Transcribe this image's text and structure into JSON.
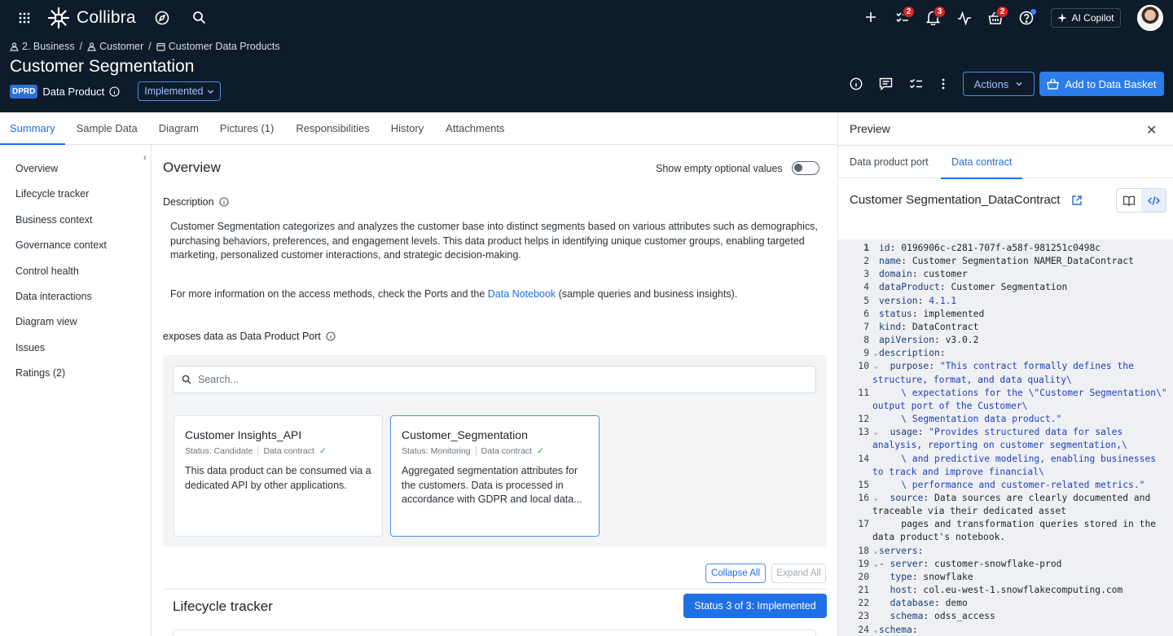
{
  "app": {
    "brand": "Collibra",
    "copilot_label": "AI Copilot",
    "tasks_count": "2",
    "notifications_count": "3",
    "basket_count": "2"
  },
  "breadcrumb": [
    "2. Business",
    "Customer",
    "Customer Data Products"
  ],
  "page": {
    "title": "Customer Segmentation",
    "type_badge": "DPRD",
    "type_label": "Data Product",
    "status": "Implemented",
    "actions_label": "Actions",
    "basket_label": "Add to Data Basket"
  },
  "tabs": [
    "Summary",
    "Sample Data",
    "Diagram",
    "Pictures (1)",
    "Responsibilities",
    "History",
    "Attachments"
  ],
  "leftnav": [
    "Overview",
    "Lifecycle tracker",
    "Business context",
    "Governance context",
    "Control health",
    "Data interactions",
    "Diagram view",
    "Issues",
    "Ratings (2)"
  ],
  "overview": {
    "heading": "Overview",
    "toggle_label": "Show empty optional values",
    "description_label": "Description",
    "description": "Customer Segmentation categorizes and analyzes the customer base into distinct segments based on various attributes such as demographics, purchasing behaviors, preferences, and engagement levels. This data product helps in identifying unique customer groups, enabling targeted marketing, personalized customer interactions, and strategic decision-making.",
    "more_info_pre": "For more information on the access methods, check the Ports and the ",
    "more_info_link": "Data Notebook",
    "more_info_post": " (sample queries and business insights).",
    "exposes_bold": "exposes data as",
    "exposes_rest": " Data Product Port",
    "search_placeholder": "Search...",
    "cards": [
      {
        "title": "Customer Insights_API",
        "status": "Status: Candidate",
        "contract": "Data contract",
        "body": "This data product can be consumed via a dedicated API by other applications."
      },
      {
        "title": "Customer_Segmentation",
        "status": "Status: Monitoring",
        "contract": "Data contract",
        "body": "Aggregated segmentation attributes for the customers. Data is processed in accordance with GDPR and local data..."
      }
    ],
    "collapse_all": "Collapse All",
    "expand_all": "Expand All",
    "lifecycle_title": "Lifecycle tracker",
    "lifecycle_status": "Status 3 of 3: Implemented"
  },
  "preview": {
    "title": "Preview",
    "tabs": [
      "Data product port",
      "Data contract"
    ],
    "contract_title": "Customer Segmentation_DataContract",
    "code_lines": [
      {
        "n": "1",
        "fold": "",
        "k": "id",
        "v": " 0196906c-c281-707f-a58f-981251c0498c"
      },
      {
        "n": "2",
        "fold": "",
        "k": "name",
        "v": " Customer Segmentation NAMER_DataContract"
      },
      {
        "n": "3",
        "fold": "",
        "k": "domain",
        "v": " customer"
      },
      {
        "n": "4",
        "fold": "",
        "k": "dataProduct",
        "v": " Customer Segmentation"
      },
      {
        "n": "5",
        "fold": "",
        "k": "version",
        "v": " 4.1.1",
        "str": true
      },
      {
        "n": "6",
        "fold": "",
        "k": "status",
        "v": " implemented"
      },
      {
        "n": "7",
        "fold": "",
        "k": "kind",
        "v": " DataContract"
      },
      {
        "n": "8",
        "fold": "",
        "k": "apiVersion",
        "v": " v3.0.2"
      },
      {
        "n": "9",
        "fold": "⌄",
        "k": "description",
        "v": ""
      },
      {
        "n": "10",
        "fold": "⌄",
        "k": "  purpose",
        "v": " \"This contract formally defines the",
        "str": true
      },
      {
        "n": "",
        "fold": "",
        "k": "",
        "v": "structure, format, and data quality\\",
        "str": true
      },
      {
        "n": "11",
        "fold": "",
        "k": "",
        "v": "    \\ expectations for the \\\"Customer Segmentation\\\"",
        "str": true
      },
      {
        "n": "",
        "fold": "",
        "k": "",
        "v": "output port of the Customer\\",
        "str": true
      },
      {
        "n": "12",
        "fold": "",
        "k": "",
        "v": "    \\ Segmentation data product.\"",
        "str": true
      },
      {
        "n": "13",
        "fold": "⌄",
        "k": "  usage",
        "v": " \"Provides structured data for sales",
        "str": true
      },
      {
        "n": "",
        "fold": "",
        "k": "",
        "v": "analysis, reporting on customer segmentation,\\",
        "str": true
      },
      {
        "n": "14",
        "fold": "",
        "k": "",
        "v": "    \\ and predictive modeling, enabling businesses",
        "str": true
      },
      {
        "n": "",
        "fold": "",
        "k": "",
        "v": "to track and improve financial\\",
        "str": true
      },
      {
        "n": "15",
        "fold": "",
        "k": "",
        "v": "    \\ performance and customer-related metrics.\"",
        "str": true
      },
      {
        "n": "16",
        "fold": "⌄",
        "k": "  source",
        "v": " Data sources are clearly documented and"
      },
      {
        "n": "",
        "fold": "",
        "k": "",
        "v": "traceable via their dedicated asset"
      },
      {
        "n": "17",
        "fold": "",
        "k": "",
        "v": "    pages and transformation queries stored in the"
      },
      {
        "n": "",
        "fold": "",
        "k": "",
        "v": "data product's notebook."
      },
      {
        "n": "18",
        "fold": "⌄",
        "k": "servers",
        "v": ""
      },
      {
        "n": "19",
        "fold": "⌄",
        "k": "- server",
        "v": " customer-snowflake-prod"
      },
      {
        "n": "20",
        "fold": "",
        "k": "  type",
        "v": " snowflake"
      },
      {
        "n": "21",
        "fold": "",
        "k": "  host",
        "v": " col.eu-west-1.snowflakecomputing.com"
      },
      {
        "n": "22",
        "fold": "",
        "k": "  database",
        "v": " demo"
      },
      {
        "n": "23",
        "fold": "",
        "k": "  schema",
        "v": " odss_access"
      },
      {
        "n": "24",
        "fold": "⌄",
        "k": "schema",
        "v": ""
      }
    ]
  },
  "colors": {
    "topbar": "#0d1b2a",
    "accent": "#1f6fe6",
    "badge": "#e02424"
  }
}
